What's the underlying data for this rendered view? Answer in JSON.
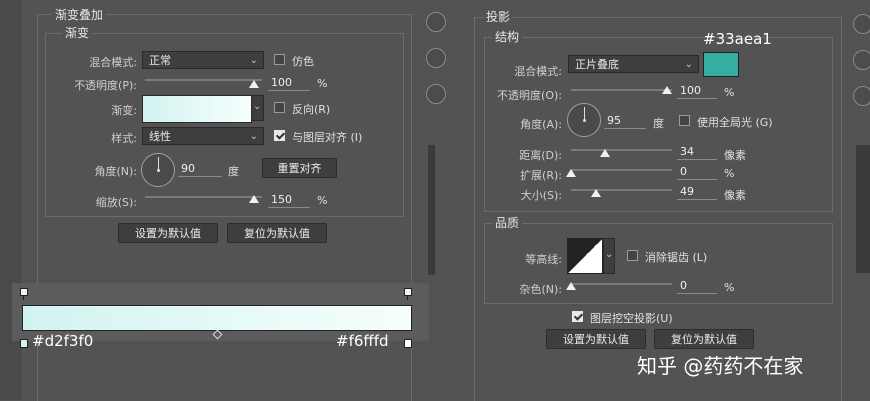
{
  "gradient_overlay": {
    "section_title": "渐变叠加",
    "group_title": "渐变",
    "blend_mode_label": "混合模式:",
    "blend_mode_value": "正常",
    "dither_label": "仿色",
    "opacity_label": "不透明度(P):",
    "opacity_value": "100",
    "opacity_unit": "%",
    "opacity_level": 1.0,
    "gradient_label": "渐变:",
    "reverse_label": "反向(R)",
    "style_label": "样式:",
    "style_value": "线性",
    "align_layer_label": "与图层对齐 (I)",
    "angle_label": "角度(N):",
    "angle_value": "90",
    "angle_unit": "度",
    "reset_align_button": "重置对齐",
    "scale_label": "缩放(S):",
    "scale_value": "150",
    "scale_unit": "%",
    "scale_level": 1.0,
    "set_default_button": "设置为默认值",
    "reset_default_button": "复位为默认值"
  },
  "gradient_bar": {
    "left_color": "#d2f3f0",
    "right_color": "#f6fffd",
    "left_label": "#d2f3f0",
    "right_label": "#f6fffd"
  },
  "drop_shadow": {
    "section_title": "投影",
    "structure_title": "结构",
    "color_label": "#33aea1",
    "color_value": "#33aea1",
    "blend_mode_label": "混合模式:",
    "blend_mode_value": "正片叠底",
    "opacity_label": "不透明度(O):",
    "opacity_value": "100",
    "opacity_unit": "%",
    "opacity_level": 1.0,
    "angle_label": "角度(A):",
    "angle_value": "95",
    "angle_unit": "度",
    "global_light_label": "使用全局光 (G)",
    "distance_label": "距离(D):",
    "distance_value": "34",
    "distance_unit": "像素",
    "spread_label": "扩展(R):",
    "spread_value": "0",
    "spread_unit": "%",
    "size_label": "大小(S):",
    "size_value": "49",
    "size_unit": "像素",
    "quality_title": "品质",
    "contour_label": "等高线:",
    "anti_alias_label": "消除锯齿 (L)",
    "noise_label": "杂色(N):",
    "noise_value": "0",
    "noise_unit": "%",
    "knockout_label": "图层挖空投影(U)",
    "set_default_button": "设置为默认值",
    "reset_default_button": "复位为默认值"
  },
  "watermark": "知乎 @药药不在家"
}
